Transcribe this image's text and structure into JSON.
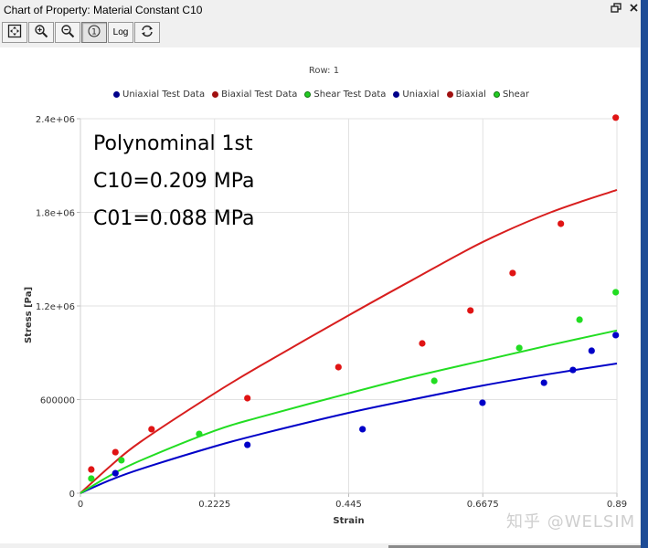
{
  "window": {
    "title": "Chart of Property: Material Constant C10",
    "restore_icon": "restore-window-icon",
    "close_icon": "close-icon"
  },
  "toolbar": {
    "buttons": [
      {
        "name": "fit-view-button",
        "icon": "fit-view-icon",
        "label": ""
      },
      {
        "name": "zoom-in-button",
        "icon": "zoom-in-icon",
        "label": ""
      },
      {
        "name": "zoom-out-button",
        "icon": "zoom-out-icon",
        "label": ""
      },
      {
        "name": "reset-zoom-button",
        "icon": "one-to-one-icon",
        "label": "①",
        "active": true
      },
      {
        "name": "log-scale-button",
        "icon": "",
        "label": "Log"
      },
      {
        "name": "refresh-button",
        "icon": "refresh-icon",
        "label": ""
      }
    ]
  },
  "annotation": {
    "line1": "Polynominal 1st",
    "line2": "C10=0.209 MPa",
    "line3": "C01=0.088 MPa"
  },
  "watermark": "知乎 @WELSIM",
  "colors": {
    "uniaxial": "#0000c8",
    "biaxial": "#d81e1e",
    "shear": "#22dd22",
    "biaxial_test": "#e01414",
    "legend_uniaxial": "#00008b",
    "legend_biaxial": "#a01010",
    "legend_shear": "#22cc22"
  },
  "chart_data": {
    "type": "scatter",
    "title": "Row: 1",
    "xlabel": "Strain",
    "ylabel": "Stress [Pa]",
    "xlim": [
      0,
      0.89
    ],
    "ylim": [
      0,
      2400000
    ],
    "xticks": [
      0,
      0.2225,
      0.445,
      0.6675,
      0.89
    ],
    "xtick_labels": [
      "0",
      "0.2225",
      "0.445",
      "0.6675",
      "0.89"
    ],
    "yticks": [
      0,
      600000,
      1200000,
      1800000,
      2400000
    ],
    "ytick_labels": [
      "0",
      "600000",
      "1.2e+06",
      "1.8e+06",
      "2.4e+06"
    ],
    "grid": true,
    "legend_position": "top",
    "legend": [
      "Uniaxial Test Data",
      "Biaxial Test Data",
      "Shear Test Data",
      "Uniaxial",
      "Biaxial",
      "Shear"
    ],
    "series": [
      {
        "name": "Uniaxial Test Data",
        "kind": "points",
        "color_key": "uniaxial",
        "x": [
          0.058,
          0.277,
          0.468,
          0.667,
          0.769,
          0.817,
          0.848,
          0.888
        ],
        "y": [
          128000,
          310000,
          410000,
          580000,
          708000,
          790000,
          913000,
          1013000
        ]
      },
      {
        "name": "Biaxial Test Data",
        "kind": "points",
        "color_key": "biaxial_test",
        "x": [
          0.018,
          0.058,
          0.118,
          0.277,
          0.428,
          0.567,
          0.647,
          0.717,
          0.797,
          0.888
        ],
        "y": [
          152000,
          263000,
          410000,
          609000,
          808000,
          960000,
          1171000,
          1411000,
          1727000,
          2407000
        ]
      },
      {
        "name": "Shear Test Data",
        "kind": "points",
        "color_key": "shear",
        "x": [
          0.018,
          0.068,
          0.197,
          0.587,
          0.728,
          0.828,
          0.888
        ],
        "y": [
          94000,
          211000,
          380000,
          720000,
          931000,
          1112000,
          1288000
        ]
      },
      {
        "name": "Uniaxial",
        "kind": "line",
        "color_key": "uniaxial",
        "x": [
          0,
          0.05,
          0.1,
          0.2225,
          0.3,
          0.445,
          0.55,
          0.6675,
          0.78,
          0.89
        ],
        "y": [
          0,
          85000,
          155000,
          300000,
          380000,
          515000,
          600000,
          690000,
          765000,
          831000
        ]
      },
      {
        "name": "Biaxial",
        "kind": "line",
        "color_key": "biaxial",
        "x": [
          0,
          0.05,
          0.1,
          0.2225,
          0.3,
          0.445,
          0.55,
          0.6675,
          0.78,
          0.89
        ],
        "y": [
          0,
          175000,
          330000,
          640000,
          820000,
          1140000,
          1365000,
          1610000,
          1800000,
          1944000
        ]
      },
      {
        "name": "Shear",
        "kind": "line",
        "color_key": "shear",
        "x": [
          0,
          0.05,
          0.1,
          0.2225,
          0.3,
          0.445,
          0.55,
          0.6675,
          0.78,
          0.89
        ],
        "y": [
          0,
          115000,
          210000,
          400000,
          490000,
          640000,
          745000,
          850000,
          950000,
          1043000
        ]
      }
    ]
  }
}
